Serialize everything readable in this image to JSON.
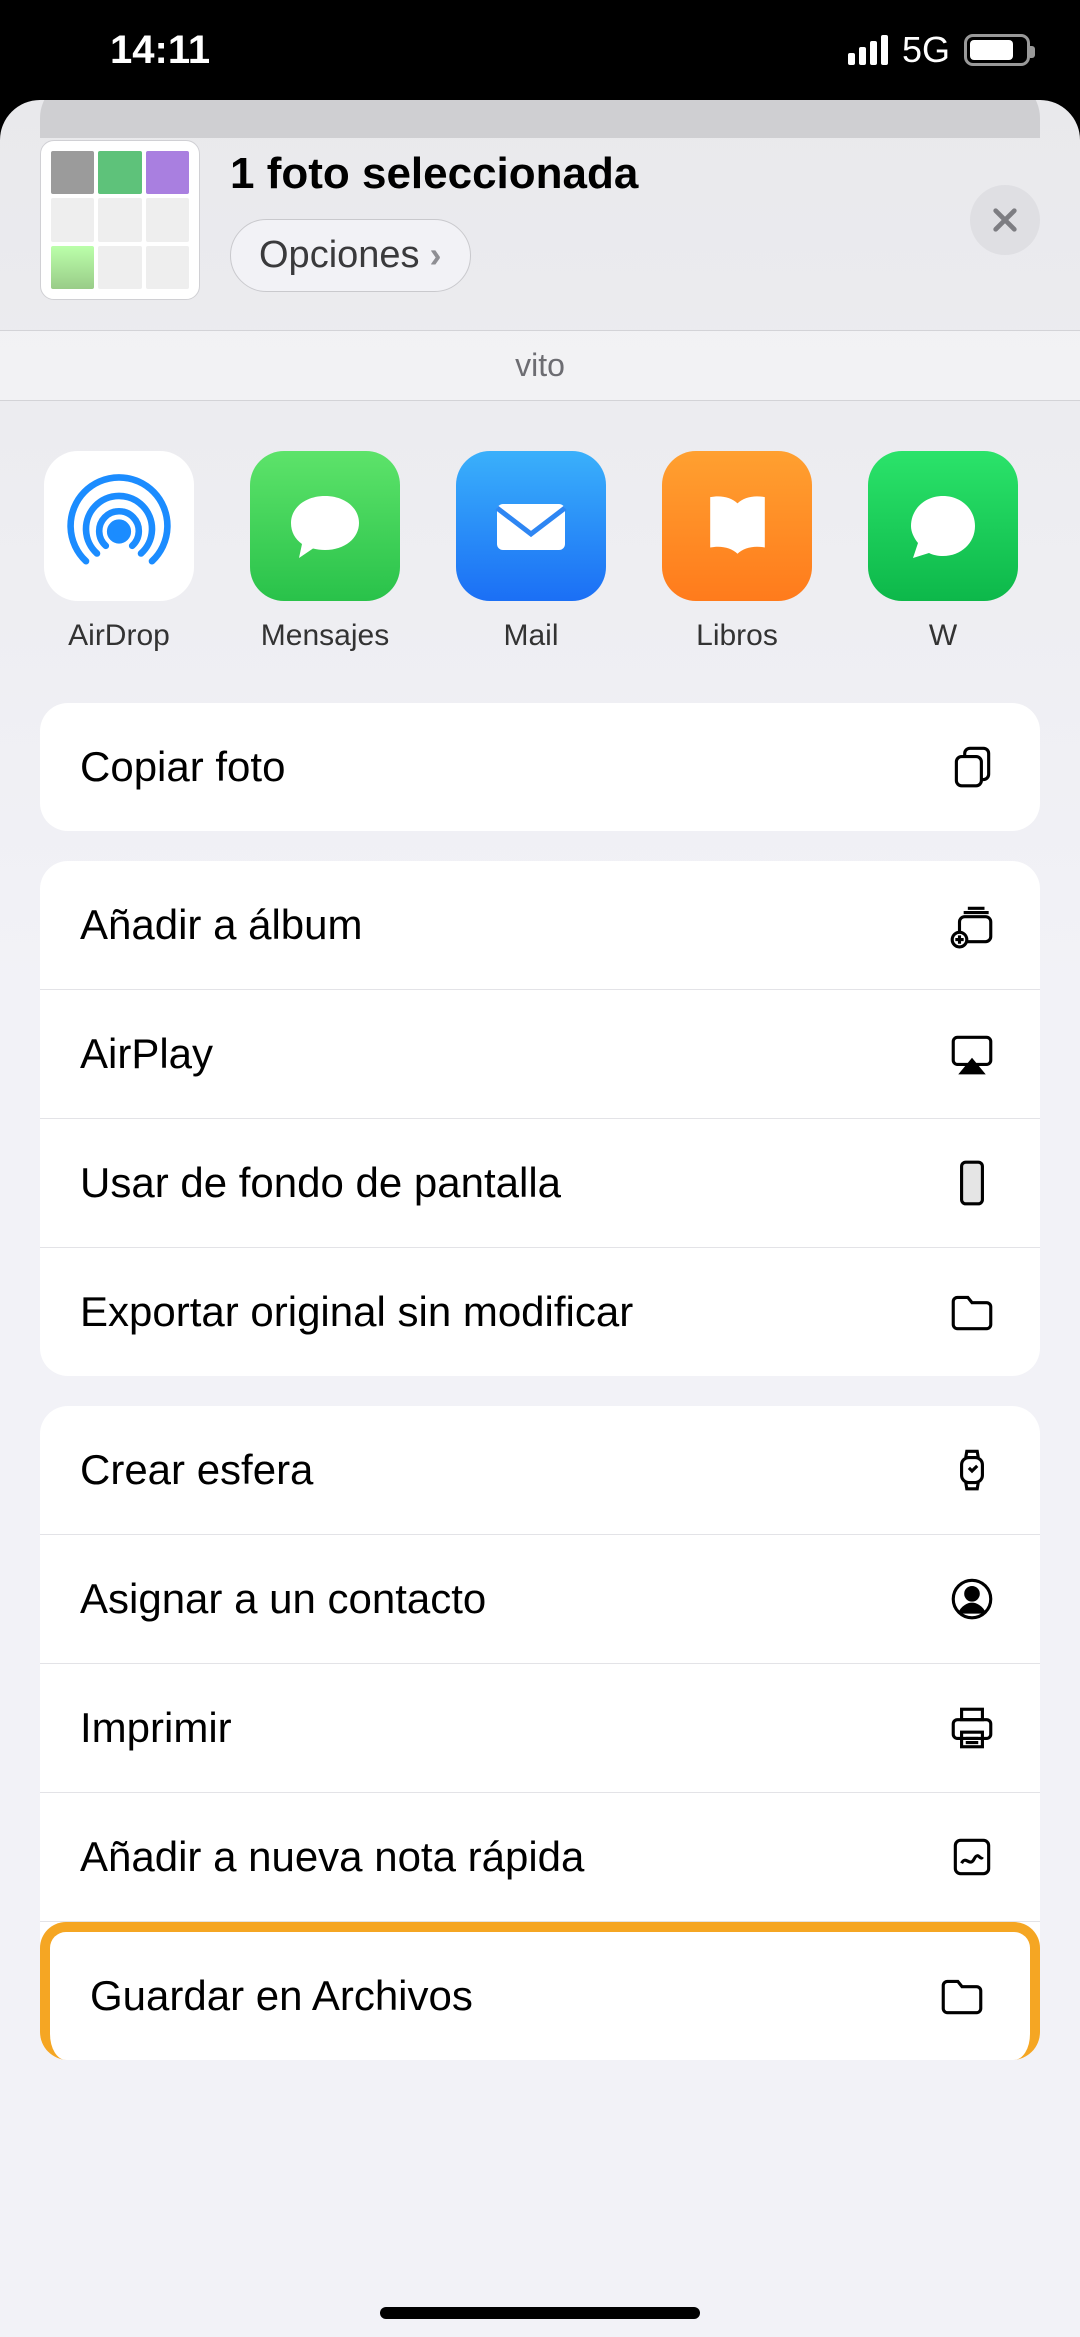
{
  "status": {
    "time": "14:11",
    "network": "5G"
  },
  "header": {
    "title": "1 foto seleccionada",
    "options": "Opciones",
    "subtitle": "vito"
  },
  "apps": [
    {
      "label": "AirDrop"
    },
    {
      "label": "Mensajes"
    },
    {
      "label": "Mail"
    },
    {
      "label": "Libros"
    },
    {
      "label": "W"
    }
  ],
  "actions_g1": [
    {
      "label": "Copiar foto"
    }
  ],
  "actions_g2": [
    {
      "label": "Añadir a álbum"
    },
    {
      "label": "AirPlay"
    },
    {
      "label": "Usar de fondo de pantalla"
    },
    {
      "label": "Exportar original sin modificar"
    }
  ],
  "actions_g3": [
    {
      "label": "Crear esfera"
    },
    {
      "label": "Asignar a un contacto"
    },
    {
      "label": "Imprimir"
    },
    {
      "label": "Añadir a nueva nota rápida"
    },
    {
      "label": "Guardar en Archivos"
    }
  ]
}
